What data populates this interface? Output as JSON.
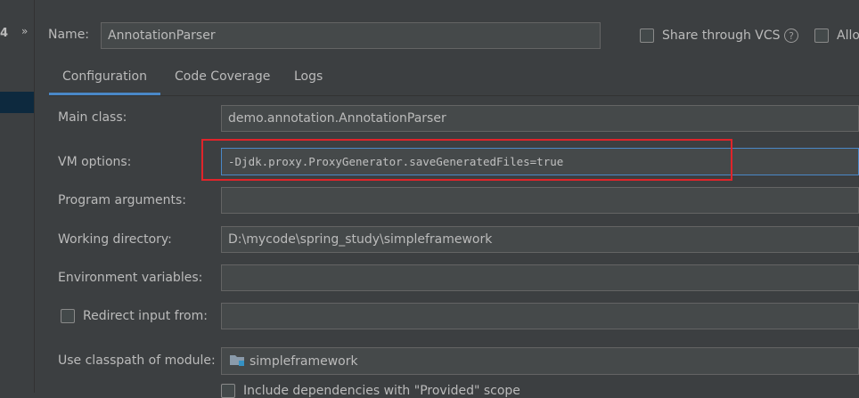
{
  "left": {
    "glyph": "4",
    "chevron": "»"
  },
  "name_label": "Name:",
  "name_value": "AnnotationParser",
  "share_vcs_label": "Share through VCS",
  "allow_label": "Allo",
  "help_glyph": "?",
  "tabs": [
    {
      "label": "Configuration"
    },
    {
      "label": "Code Coverage"
    },
    {
      "label": "Logs"
    }
  ],
  "fields": {
    "main_class": {
      "label": "Main class:",
      "value": "demo.annotation.AnnotationParser"
    },
    "vm_options": {
      "label": "VM options:",
      "value": "-Djdk.proxy.ProxyGenerator.saveGeneratedFiles=true"
    },
    "program_arguments": {
      "label": "Program arguments:",
      "value": ""
    },
    "working_directory": {
      "label": "Working directory:",
      "value": "D:\\mycode\\spring_study\\simpleframework"
    },
    "environment_variables": {
      "label": "Environment variables:",
      "value": ""
    },
    "redirect_input": {
      "label": "Redirect input from:",
      "value": ""
    },
    "classpath_module": {
      "label": "Use classpath of module:",
      "value": "simpleframework"
    },
    "include_dependencies": {
      "label": "Include dependencies with \"Provided\" scope"
    }
  },
  "colors": {
    "accent": "#4a88c7",
    "highlight_box": "#e0242a",
    "background": "#3c3f41"
  }
}
